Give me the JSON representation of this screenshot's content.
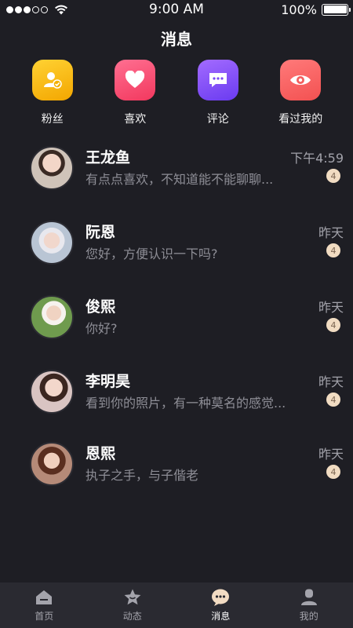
{
  "status_bar": {
    "time": "9:00 AM",
    "battery": "100%",
    "battery_level": 1.0
  },
  "header": {
    "title": "消息"
  },
  "quick_actions": [
    {
      "label": "粉丝",
      "icon": "user-check-icon",
      "color": "#f6b800"
    },
    {
      "label": "喜欢",
      "icon": "heart-icon",
      "color": "#f4486c"
    },
    {
      "label": "评论",
      "icon": "comment-icon",
      "color": "#7b48f5"
    },
    {
      "label": "看过我的",
      "icon": "eye-icon",
      "color": "#f45f5f"
    }
  ],
  "chats": [
    {
      "name": "王龙鱼",
      "message": "有点点喜欢，不知道能不能聊聊...",
      "time": "下午4:59",
      "unread": "4"
    },
    {
      "name": "阮恩",
      "message": "您好，方便认识一下吗?",
      "time": "昨天",
      "unread": "4"
    },
    {
      "name": "俊熙",
      "message": "你好?",
      "time": "昨天",
      "unread": "4"
    },
    {
      "name": "李明昊",
      "message": "看到你的照片，有一种莫名的感觉...",
      "time": "昨天",
      "unread": "4"
    },
    {
      "name": "恩熙",
      "message": "执子之手，与子偕老",
      "time": "昨天",
      "unread": "4"
    }
  ],
  "tab_bar": {
    "tabs": [
      {
        "label": "首页",
        "icon": "home-icon"
      },
      {
        "label": "动态",
        "icon": "star-icon"
      },
      {
        "label": "消息",
        "icon": "message-icon",
        "active": true
      },
      {
        "label": "我的",
        "icon": "profile-icon"
      }
    ]
  },
  "colors": {
    "background": "#1e1e24",
    "tab_bar": "#2a2a31",
    "badge": "#f1dcc2"
  }
}
